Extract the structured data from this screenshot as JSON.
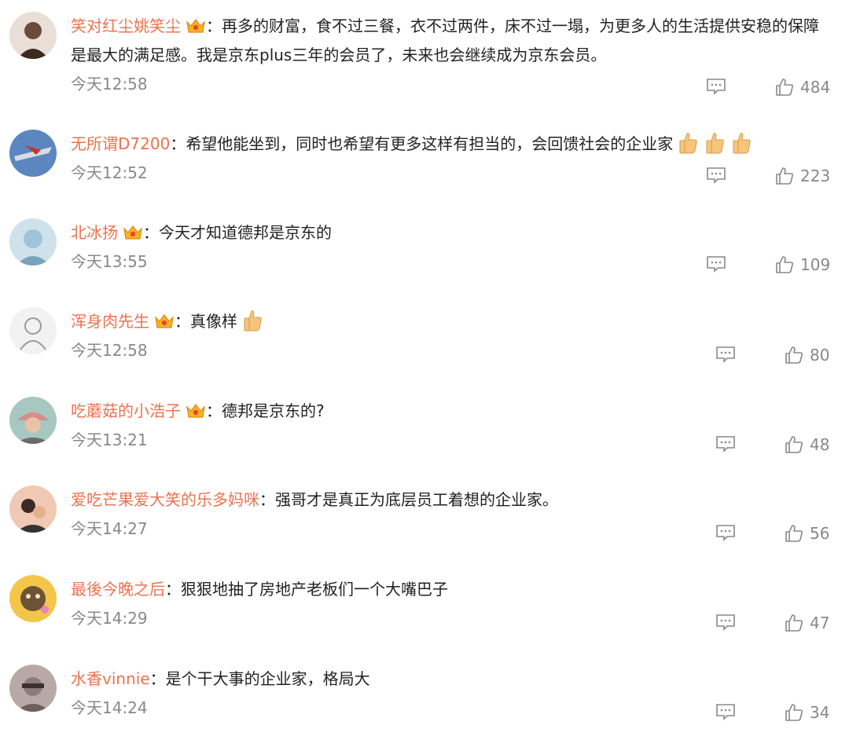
{
  "separator": "：",
  "comments": [
    {
      "user": "笑对红尘姚笑尘",
      "vip": true,
      "text": "再多的财富，食不过三餐，衣不过两件，床不过一塌，为更多人的生活提供安稳的保障是最大的满足感。我是京东plus三年的会员了，未来也会继续成为京东会员。",
      "thumbs": 0,
      "time": "今天12:58",
      "likes": "484",
      "avatar": "#6b4c3b"
    },
    {
      "user": "无所谓D7200",
      "vip": false,
      "text": "希望他能坐到，同时也希望有更多这样有担当的，会回馈社会的企业家",
      "thumbs": 3,
      "time": "今天12:52",
      "likes": "223",
      "avatar": "#4a78b5"
    },
    {
      "user": "北冰扬",
      "vip": true,
      "text": "今天才知道德邦是京东的",
      "thumbs": 0,
      "time": "今天13:55",
      "likes": "109",
      "avatar": "#9fc3d8"
    },
    {
      "user": "浑身肉先生",
      "vip": true,
      "text": "真像样",
      "thumbs": 1,
      "time": "今天12:58",
      "likes": "80",
      "avatar": "#e8e8e8"
    },
    {
      "user": "吃蘑菇的小浩子",
      "vip": true,
      "text": "德邦是京东的?",
      "thumbs": 0,
      "time": "今天13:21",
      "likes": "48",
      "avatar": "#c98a7a"
    },
    {
      "user": "爱吃芒果爱大笑的乐多妈咪",
      "vip": false,
      "text": "强哥才是真正为底层员工着想的企业家。",
      "thumbs": 0,
      "time": "今天14:27",
      "likes": "56",
      "avatar": "#e0a58a"
    },
    {
      "user": "最後今晚之后",
      "vip": false,
      "text": "狠狠地抽了房地产老板们一个大嘴巴子",
      "thumbs": 0,
      "time": "今天14:29",
      "likes": "47",
      "avatar": "#e7b640"
    },
    {
      "user": "水香vinnie",
      "vip": false,
      "text": "是个干大事的企业家，格局大",
      "thumbs": 0,
      "time": "今天14:24",
      "likes": "34",
      "avatar": "#8f7b78"
    }
  ]
}
